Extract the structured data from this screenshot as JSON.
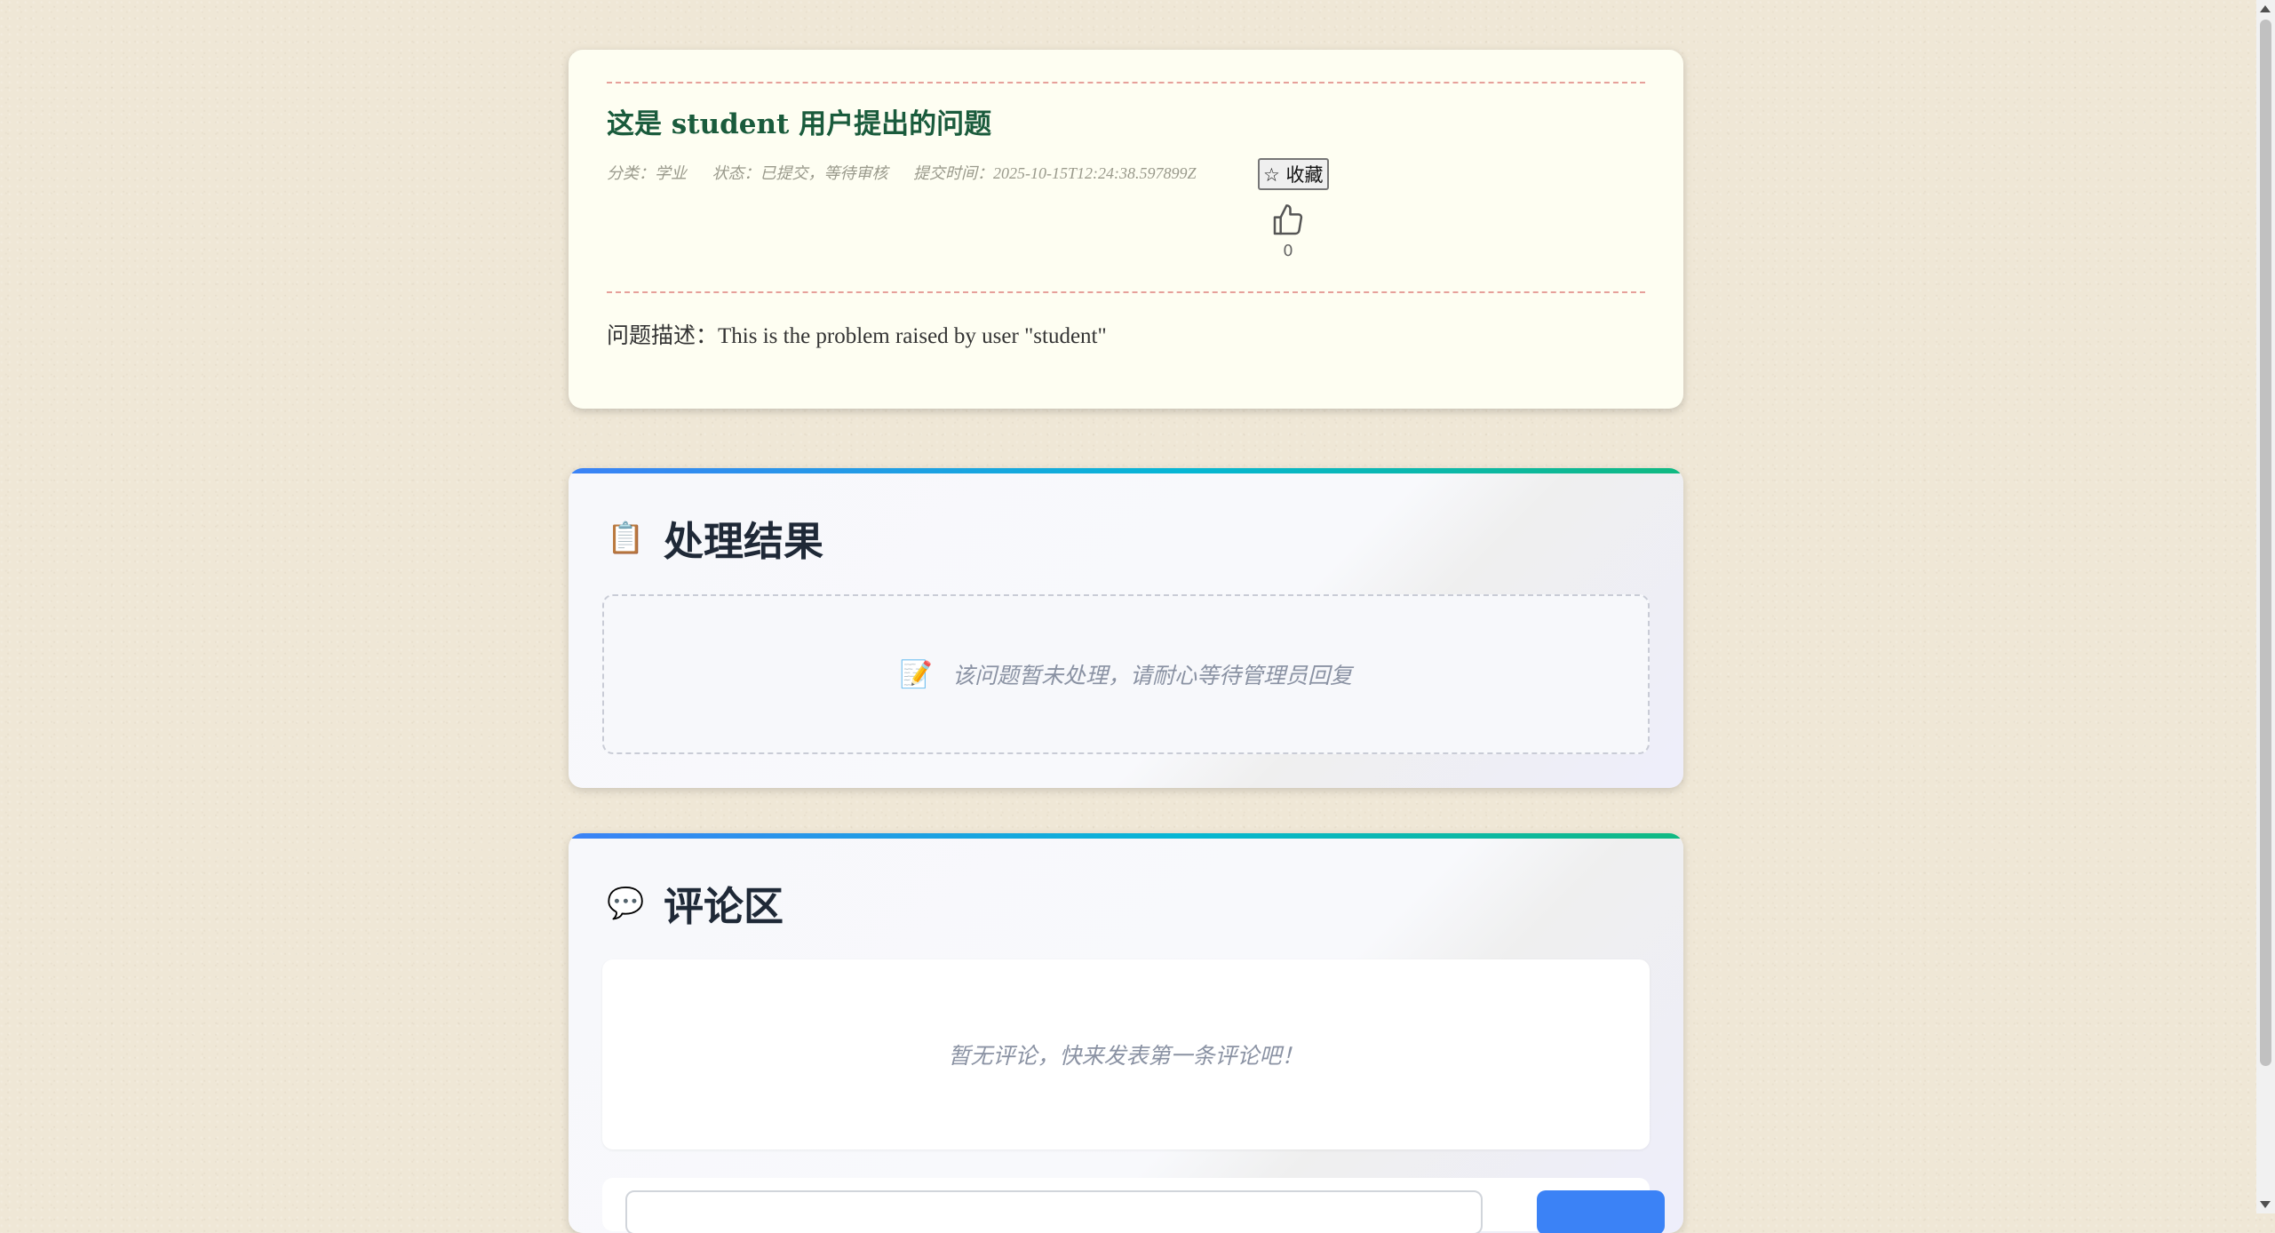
{
  "question": {
    "title": "这是 student 用户提出的问题",
    "category": "分类：学业",
    "status": "状态：已提交，等待审核",
    "submit_time": "提交时间：2025-10-15T12:24:38.597899Z",
    "favorite_label": "☆ 收藏",
    "like_count": "0",
    "description": "问题描述：This is the problem raised by user \"student\""
  },
  "result_section": {
    "icon": "📋",
    "title": "处理结果",
    "empty_icon": "📝",
    "empty_text": "该问题暂未处理，请耐心等待管理员回复"
  },
  "comments_section": {
    "icon": "💬",
    "title": "评论区",
    "empty_text": "暂无评论，快来发表第一条评论吧！"
  },
  "colors": {
    "title_green": "#1a5b3c",
    "accent_blue": "#3b82f6",
    "accent_green": "#10b981",
    "dash_red": "#e6a09a"
  }
}
